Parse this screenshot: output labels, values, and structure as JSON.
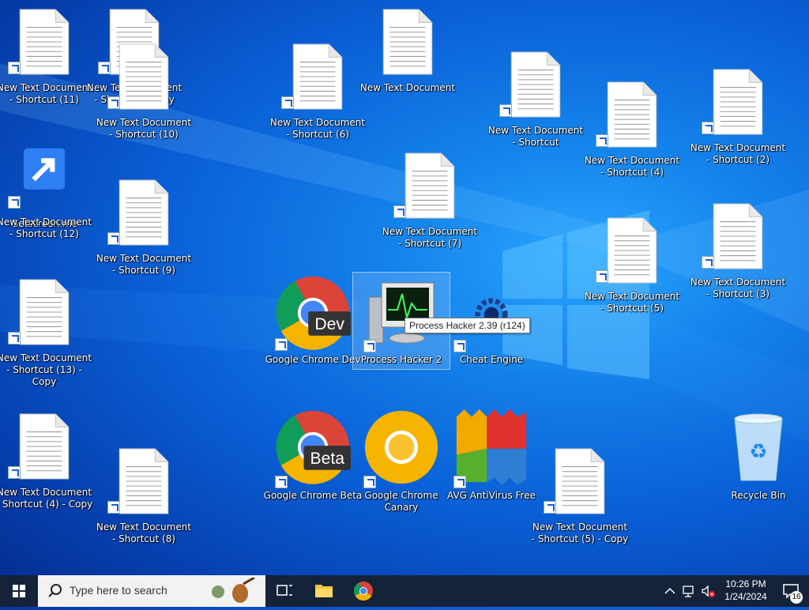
{
  "desktop": {
    "icons": [
      {
        "label": "New Text Document - Shortcut (11)",
        "type": "textdoc"
      },
      {
        "label": "New Text Document - Shortcut - Copy",
        "type": "textdoc"
      },
      {
        "label": "New Text Document - Shortcut (10)",
        "type": "textdoc"
      },
      {
        "label": "New Text Document - Shortcut (6)",
        "type": "textdoc"
      },
      {
        "label": "New Text Document",
        "type": "textdoc"
      },
      {
        "label": "New Text Document - Shortcut",
        "type": "textdoc"
      },
      {
        "label": "New Text Document - Shortcut (4)",
        "type": "textdoc"
      },
      {
        "label": "New Text Document - Shortcut (2)",
        "type": "textdoc"
      },
      {
        "label": "Getscreen.me",
        "type": "app"
      },
      {
        "label": "New Text Document - Shortcut (12)",
        "type": "textdoc"
      },
      {
        "label": "New Text Document - Shortcut (9)",
        "type": "textdoc"
      },
      {
        "label": "New Text Document - Shortcut (7)",
        "type": "textdoc"
      },
      {
        "label": "New Text Document - Shortcut (5)",
        "type": "textdoc"
      },
      {
        "label": "New Text Document - Shortcut (3)",
        "type": "textdoc"
      },
      {
        "label": "New Text Document - Shortcut (13) - Copy",
        "type": "textdoc"
      },
      {
        "label": "Google Chrome Dev",
        "type": "chrome-dev"
      },
      {
        "label": "Process Hacker 2",
        "type": "processhacker"
      },
      {
        "label": "Cheat Engine",
        "type": "cheatengine"
      },
      {
        "label": "New Text Document - Shortcut (4) - Copy",
        "type": "textdoc"
      },
      {
        "label": "New Text Document - Shortcut (8)",
        "type": "textdoc"
      },
      {
        "label": "Google Chrome Beta",
        "type": "chrome-beta"
      },
      {
        "label": "Google Chrome Canary",
        "type": "chrome-canary"
      },
      {
        "label": "AVG AntiVirus Free",
        "type": "avg"
      },
      {
        "label": "New Text Document - Shortcut (5) - Copy",
        "type": "textdoc"
      },
      {
        "label": "Recycle Bin",
        "type": "recyclebin"
      }
    ],
    "tooltip": "Process Hacker 2.39 (r124)"
  },
  "taskbar": {
    "search_placeholder": "Type here to search",
    "clock_time": "10:26 PM",
    "clock_date": "1/24/2024",
    "notification_count": "16"
  },
  "colors": {
    "accent": "#0a5fd6",
    "taskbar": "#14233a"
  }
}
